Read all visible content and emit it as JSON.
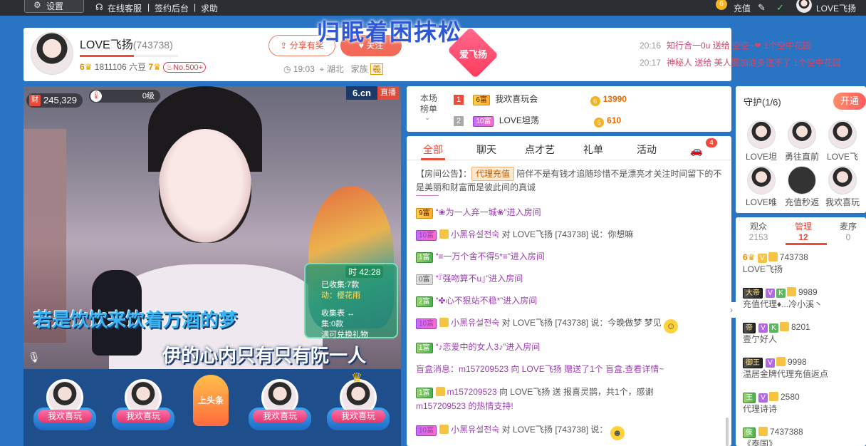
{
  "topbar": {
    "settings": "设置",
    "service": "在线客服",
    "sign_backend": "签约后台",
    "help": "求助",
    "recharge": "充值",
    "username": "LOVE飞扬"
  },
  "header": {
    "anchor_name": "LOVE飞扬",
    "room_id": "(743738)",
    "level_a": "6",
    "beans": "1811106 六豆",
    "level_b": "7",
    "rank_badge": "No.500+",
    "share_label": "分享有奖",
    "follow_label": "关注",
    "overlay_title": "归眠着困抹松",
    "gift_name": "爱飞扬",
    "time": "19:03",
    "location": "湖北",
    "family_label": "家族",
    "family_badge": "羲"
  },
  "gift_log": [
    {
      "time": "20:16",
      "text": "知行合一0u 送给 空空~❤ 1个空中花园"
    },
    {
      "time": "20:17",
      "text": "神秘人 送给 美人要加油多送不了 1个空中花园"
    }
  ],
  "video": {
    "fortune": "245,329",
    "level": "0级",
    "brand": "6.cn",
    "live": "直播",
    "lyric_1": "若是饮饮来饮着万酒的梦",
    "lyric_2": "伊的心内只有只有阮一人",
    "timer": "时 42:28",
    "collect_1": "已收集:7款",
    "collect_2": "动：樱花雨",
    "collect_3": "收集表 ↔",
    "collect_4": "集:0款",
    "collect_5": "满可兑换礼物"
  },
  "seats": [
    {
      "name": "我欢喜玩"
    },
    {
      "name": "我欢喜玩"
    },
    {
      "name": "我欢喜玩"
    },
    {
      "name": "我欢喜玩"
    }
  ],
  "headline_label": "上头条",
  "rank": {
    "label": "本场榜单",
    "rows": [
      {
        "num": "1",
        "badge": "6富",
        "name": "我欢喜玩会",
        "score": "13990"
      },
      {
        "num": "2",
        "badge": "10富",
        "name": "LOVE坦荡",
        "score": "610"
      }
    ]
  },
  "chat": {
    "tabs": [
      "全部",
      "聊天",
      "点才艺",
      "礼单",
      "活动"
    ],
    "vehicle_count": "4",
    "notice_prefix": "【房间公告】：",
    "notice_tag": "代理充值",
    "notice_text": "陪伴不是有钱才追随珍惜不是漂亮才关注时间留下的不是美丽和财富而是彼此间的真诚",
    "messages": [
      {
        "badge": "9富",
        "text": "“❀为一人弃一城❀”进入房间"
      },
      {
        "badge": "10富",
        "nick": "小黑유설전숙",
        "text": " 对 LOVE飞扬 [743738] 说：你想嘛"
      },
      {
        "badge": "1富",
        "text": "“≡一万个舍不得5*≡”进入房间"
      },
      {
        "badge": "0富",
        "text": "“『强吻算不u』”进入房间"
      },
      {
        "badge": "2富",
        "text": "“✤心不狠站不稳*”进入房间"
      },
      {
        "badge": "10富",
        "nick": "小黑유설전숙",
        "text": " 对 LOVE飞扬 [743738] 说：今晚做梦 梦见"
      },
      {
        "badge": "1富",
        "text": "“♪恋爱中的女人3♪”进入房间"
      },
      {
        "text": "盲盒消息：m157209523 向 LOVE飞扬 赠送了1个  盲盒,查看详情~"
      },
      {
        "badge": "1富",
        "nick": "m157209523",
        "text": " 向 LOVE飞扬 送  报喜灵鹊，共1个，感谢",
        "text2": "m157209523 的热情支持!"
      },
      {
        "badge": "10富",
        "nick": "小黑유설전숙",
        "text": " 对 LOVE飞扬 [743738] 说："
      }
    ]
  },
  "guard": {
    "title": "守护(1/6)",
    "open_label": "开通",
    "members": [
      "LOVE坦",
      "勇往直前",
      "LOVE飞",
      "LOVE唯",
      "充值秒返",
      "我欢喜玩"
    ]
  },
  "audience": {
    "tabs": [
      {
        "label": "观众",
        "count": "2153"
      },
      {
        "label": "管理",
        "count": "12"
      },
      {
        "label": "麦序",
        "count": "0"
      }
    ],
    "rows": [
      {
        "id": "743738",
        "name": "LOVE飞扬",
        "badge": "6"
      },
      {
        "id": "9989",
        "name": "充值代理♦...冷小溪丶",
        "badge": "大帝"
      },
      {
        "id": "8201",
        "name": "壹亇好人",
        "badge": "帝"
      },
      {
        "id": "9998",
        "name": "温居金牌代理充值返点",
        "badge": "御王"
      },
      {
        "id": "2580",
        "name": "代理诗诗",
        "badge": "王"
      },
      {
        "id": "7437388",
        "name": "《泰国》",
        "badge": "侯"
      }
    ]
  },
  "colors": {
    "accent": "#f04a3a",
    "page_bg": "#2a74c4",
    "nick_purple": "#9b3fb3"
  }
}
